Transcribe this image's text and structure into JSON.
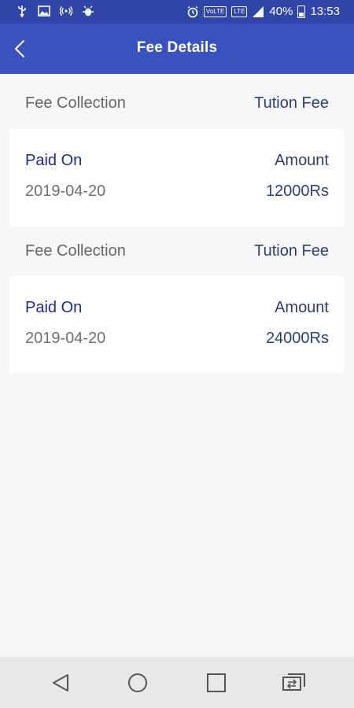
{
  "status_bar": {
    "battery_percent": "40%",
    "time": "13:53",
    "volte_label": "VoLTE",
    "lte_label": "LTE"
  },
  "app_bar": {
    "title": "Fee Details"
  },
  "fee_groups": [
    {
      "category": "Fee Collection",
      "fee_type": "Tution Fee",
      "paid_on_label": "Paid On",
      "amount_label": "Amount",
      "paid_on": "2019-04-20",
      "amount": "12000Rs"
    },
    {
      "category": "Fee Collection",
      "fee_type": "Tution Fee",
      "paid_on_label": "Paid On",
      "amount_label": "Amount",
      "paid_on": "2019-04-20",
      "amount": "24000Rs"
    }
  ],
  "colors": {
    "status_bar": "#2f45a8",
    "app_bar": "#3a52bf",
    "background": "#f7f7f7",
    "card": "#ffffff",
    "nav_bar": "#e8e8ea"
  }
}
